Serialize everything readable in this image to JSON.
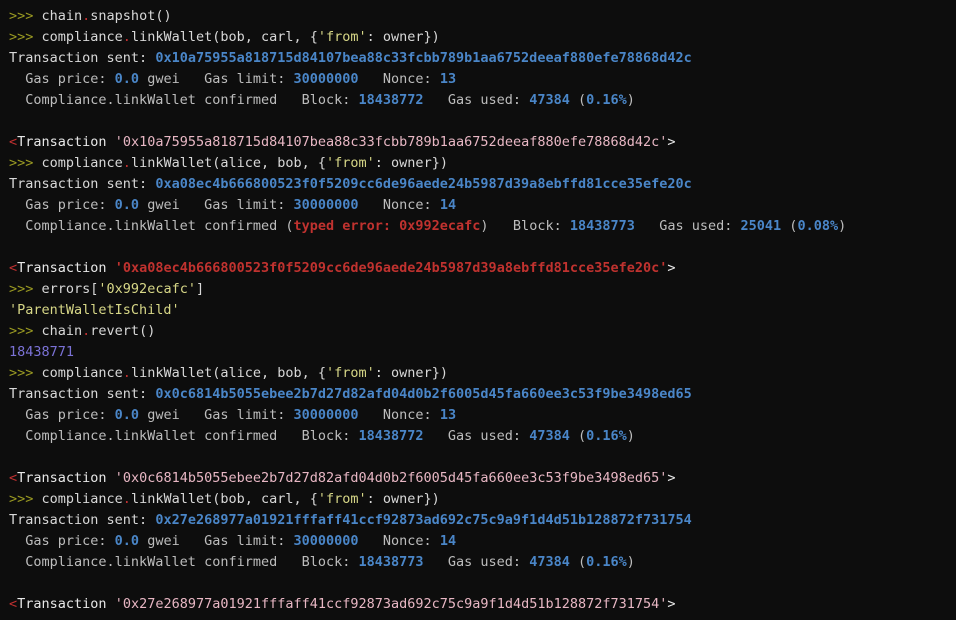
{
  "terminal": {
    "title": "Brownie console",
    "background": "#0d0d0d",
    "colors": {
      "prompt": "#9a9a22",
      "text": "#d8d8d8",
      "dot": "#c03030",
      "string": "#d7d787",
      "hash": "#4a86c8",
      "number": "#4a86c8",
      "block_number": "#7b72d6",
      "error": "#c0322f",
      "tx_hash_success": "#e8b7c4",
      "tx_hash_reverted": "#c0322f"
    },
    "lines": [
      {
        "name": "repl-command",
        "tokens": [
          {
            "class": "tok-prompt",
            "text": ">>> "
          },
          {
            "class": "tok-plain",
            "text": "chain"
          },
          {
            "class": "tok-dot",
            "text": "."
          },
          {
            "class": "tok-plain",
            "text": "snapshot()"
          }
        ]
      },
      {
        "name": "repl-command",
        "tokens": [
          {
            "class": "tok-prompt",
            "text": ">>> "
          },
          {
            "class": "tok-plain",
            "text": "compliance"
          },
          {
            "class": "tok-dot",
            "text": "."
          },
          {
            "class": "tok-plain",
            "text": "linkWallet(bob, carl, {"
          },
          {
            "class": "tok-string",
            "text": "'from'"
          },
          {
            "class": "tok-plain",
            "text": ": owner})"
          }
        ]
      },
      {
        "name": "transaction-sent",
        "tokens": [
          {
            "class": "tok-plain",
            "text": "Transaction sent: "
          },
          {
            "class": "tok-hash",
            "text": "0x10a75955a818715d84107bea88c33fcbb789b1aa6752deeaf880efe78868d42c"
          }
        ]
      },
      {
        "name": "gas-info",
        "tokens": [
          {
            "class": "tok-label",
            "text": "  Gas price: "
          },
          {
            "class": "tok-num",
            "text": "0.0"
          },
          {
            "class": "tok-label",
            "text": " gwei   Gas limit: "
          },
          {
            "class": "tok-num",
            "text": "30000000"
          },
          {
            "class": "tok-label",
            "text": "   Nonce: "
          },
          {
            "class": "tok-num",
            "text": "13"
          }
        ]
      },
      {
        "name": "confirmation",
        "tokens": [
          {
            "class": "tok-label",
            "text": "  Compliance.linkWallet confirmed   Block: "
          },
          {
            "class": "tok-num",
            "text": "18438772"
          },
          {
            "class": "tok-label",
            "text": "   Gas used: "
          },
          {
            "class": "tok-num",
            "text": "47384"
          },
          {
            "class": "tok-label",
            "text": " ("
          },
          {
            "class": "tok-num",
            "text": "0.16%"
          },
          {
            "class": "tok-label",
            "text": ")"
          }
        ]
      },
      {
        "name": "blank-line",
        "tokens": [
          {
            "class": "tok-plain",
            "text": " "
          }
        ]
      },
      {
        "name": "transaction-repr",
        "tokens": [
          {
            "class": "tok-angle",
            "text": "<"
          },
          {
            "class": "tok-txname",
            "text": "Transaction "
          },
          {
            "class": "tok-txhash",
            "text": "'0x10a75955a818715d84107bea88c33fcbb789b1aa6752deeaf880efe78868d42c'"
          },
          {
            "class": "tok-txname",
            "text": ">"
          }
        ]
      },
      {
        "name": "repl-command",
        "tokens": [
          {
            "class": "tok-prompt",
            "text": ">>> "
          },
          {
            "class": "tok-plain",
            "text": "compliance"
          },
          {
            "class": "tok-dot",
            "text": "."
          },
          {
            "class": "tok-plain",
            "text": "linkWallet(alice, bob, {"
          },
          {
            "class": "tok-string",
            "text": "'from'"
          },
          {
            "class": "tok-plain",
            "text": ": owner})"
          }
        ]
      },
      {
        "name": "transaction-sent",
        "tokens": [
          {
            "class": "tok-plain",
            "text": "Transaction sent: "
          },
          {
            "class": "tok-hash",
            "text": "0xa08ec4b666800523f0f5209cc6de96aede24b5987d39a8ebffd81cce35efe20c"
          }
        ]
      },
      {
        "name": "gas-info",
        "tokens": [
          {
            "class": "tok-label",
            "text": "  Gas price: "
          },
          {
            "class": "tok-num",
            "text": "0.0"
          },
          {
            "class": "tok-label",
            "text": " gwei   Gas limit: "
          },
          {
            "class": "tok-num",
            "text": "30000000"
          },
          {
            "class": "tok-label",
            "text": "   Nonce: "
          },
          {
            "class": "tok-num",
            "text": "14"
          }
        ]
      },
      {
        "name": "confirmation-with-error",
        "tokens": [
          {
            "class": "tok-label",
            "text": "  Compliance.linkWallet confirmed ("
          },
          {
            "class": "tok-error",
            "text": "typed error: 0x992ecafc"
          },
          {
            "class": "tok-label",
            "text": ")   Block: "
          },
          {
            "class": "tok-num",
            "text": "18438773"
          },
          {
            "class": "tok-label",
            "text": "   Gas used: "
          },
          {
            "class": "tok-num",
            "text": "25041"
          },
          {
            "class": "tok-label",
            "text": " ("
          },
          {
            "class": "tok-num",
            "text": "0.08%"
          },
          {
            "class": "tok-label",
            "text": ")"
          }
        ]
      },
      {
        "name": "blank-line",
        "tokens": [
          {
            "class": "tok-plain",
            "text": " "
          }
        ]
      },
      {
        "name": "transaction-repr-reverted",
        "tokens": [
          {
            "class": "tok-angle",
            "text": "<"
          },
          {
            "class": "tok-txname",
            "text": "Transaction "
          },
          {
            "class": "tok-txhash-err",
            "text": "'0xa08ec4b666800523f0f5209cc6de96aede24b5987d39a8ebffd81cce35efe20c'"
          },
          {
            "class": "tok-txname",
            "text": ">"
          }
        ]
      },
      {
        "name": "repl-command",
        "tokens": [
          {
            "class": "tok-prompt",
            "text": ">>> "
          },
          {
            "class": "tok-plain",
            "text": "errors["
          },
          {
            "class": "tok-string",
            "text": "'0x992ecafc'"
          },
          {
            "class": "tok-plain",
            "text": "]"
          }
        ]
      },
      {
        "name": "repl-output",
        "tokens": [
          {
            "class": "tok-string",
            "text": "'ParentWalletIsChild'"
          }
        ]
      },
      {
        "name": "repl-command",
        "tokens": [
          {
            "class": "tok-prompt",
            "text": ">>> "
          },
          {
            "class": "tok-plain",
            "text": "chain"
          },
          {
            "class": "tok-dot",
            "text": "."
          },
          {
            "class": "tok-plain",
            "text": "revert()"
          }
        ]
      },
      {
        "name": "repl-output",
        "tokens": [
          {
            "class": "tok-block",
            "text": "18438771"
          }
        ]
      },
      {
        "name": "repl-command",
        "tokens": [
          {
            "class": "tok-prompt",
            "text": ">>> "
          },
          {
            "class": "tok-plain",
            "text": "compliance"
          },
          {
            "class": "tok-dot",
            "text": "."
          },
          {
            "class": "tok-plain",
            "text": "linkWallet(alice, bob, {"
          },
          {
            "class": "tok-string",
            "text": "'from'"
          },
          {
            "class": "tok-plain",
            "text": ": owner})"
          }
        ]
      },
      {
        "name": "transaction-sent",
        "tokens": [
          {
            "class": "tok-plain",
            "text": "Transaction sent: "
          },
          {
            "class": "tok-hash",
            "text": "0x0c6814b5055ebee2b7d27d82afd04d0b2f6005d45fa660ee3c53f9be3498ed65"
          }
        ]
      },
      {
        "name": "gas-info",
        "tokens": [
          {
            "class": "tok-label",
            "text": "  Gas price: "
          },
          {
            "class": "tok-num",
            "text": "0.0"
          },
          {
            "class": "tok-label",
            "text": " gwei   Gas limit: "
          },
          {
            "class": "tok-num",
            "text": "30000000"
          },
          {
            "class": "tok-label",
            "text": "   Nonce: "
          },
          {
            "class": "tok-num",
            "text": "13"
          }
        ]
      },
      {
        "name": "confirmation",
        "tokens": [
          {
            "class": "tok-label",
            "text": "  Compliance.linkWallet confirmed   Block: "
          },
          {
            "class": "tok-num",
            "text": "18438772"
          },
          {
            "class": "tok-label",
            "text": "   Gas used: "
          },
          {
            "class": "tok-num",
            "text": "47384"
          },
          {
            "class": "tok-label",
            "text": " ("
          },
          {
            "class": "tok-num",
            "text": "0.16%"
          },
          {
            "class": "tok-label",
            "text": ")"
          }
        ]
      },
      {
        "name": "blank-line",
        "tokens": [
          {
            "class": "tok-plain",
            "text": " "
          }
        ]
      },
      {
        "name": "transaction-repr",
        "tokens": [
          {
            "class": "tok-angle",
            "text": "<"
          },
          {
            "class": "tok-txname",
            "text": "Transaction "
          },
          {
            "class": "tok-txhash",
            "text": "'0x0c6814b5055ebee2b7d27d82afd04d0b2f6005d45fa660ee3c53f9be3498ed65'"
          },
          {
            "class": "tok-txname",
            "text": ">"
          }
        ]
      },
      {
        "name": "repl-command",
        "tokens": [
          {
            "class": "tok-prompt",
            "text": ">>> "
          },
          {
            "class": "tok-plain",
            "text": "compliance"
          },
          {
            "class": "tok-dot",
            "text": "."
          },
          {
            "class": "tok-plain",
            "text": "linkWallet(bob, carl, {"
          },
          {
            "class": "tok-string",
            "text": "'from'"
          },
          {
            "class": "tok-plain",
            "text": ": owner})"
          }
        ]
      },
      {
        "name": "transaction-sent",
        "tokens": [
          {
            "class": "tok-plain",
            "text": "Transaction sent: "
          },
          {
            "class": "tok-hash",
            "text": "0x27e268977a01921fffaff41ccf92873ad692c75c9a9f1d4d51b128872f731754"
          }
        ]
      },
      {
        "name": "gas-info",
        "tokens": [
          {
            "class": "tok-label",
            "text": "  Gas price: "
          },
          {
            "class": "tok-num",
            "text": "0.0"
          },
          {
            "class": "tok-label",
            "text": " gwei   Gas limit: "
          },
          {
            "class": "tok-num",
            "text": "30000000"
          },
          {
            "class": "tok-label",
            "text": "   Nonce: "
          },
          {
            "class": "tok-num",
            "text": "14"
          }
        ]
      },
      {
        "name": "confirmation",
        "tokens": [
          {
            "class": "tok-label",
            "text": "  Compliance.linkWallet confirmed   Block: "
          },
          {
            "class": "tok-num",
            "text": "18438773"
          },
          {
            "class": "tok-label",
            "text": "   Gas used: "
          },
          {
            "class": "tok-num",
            "text": "47384"
          },
          {
            "class": "tok-label",
            "text": " ("
          },
          {
            "class": "tok-num",
            "text": "0.16%"
          },
          {
            "class": "tok-label",
            "text": ")"
          }
        ]
      },
      {
        "name": "blank-line",
        "tokens": [
          {
            "class": "tok-plain",
            "text": " "
          }
        ]
      },
      {
        "name": "transaction-repr",
        "tokens": [
          {
            "class": "tok-angle",
            "text": "<"
          },
          {
            "class": "tok-txname",
            "text": "Transaction "
          },
          {
            "class": "tok-txhash",
            "text": "'0x27e268977a01921fffaff41ccf92873ad692c75c9a9f1d4d51b128872f731754'"
          },
          {
            "class": "tok-txname",
            "text": ">"
          }
        ]
      }
    ]
  }
}
